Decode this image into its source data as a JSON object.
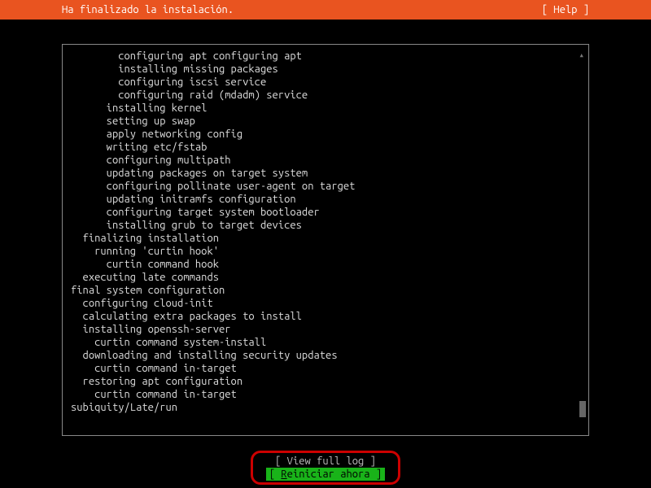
{
  "header": {
    "title": "Ha finalizado la instalación.",
    "help": "[ Help ]"
  },
  "log": {
    "lines": [
      "        configuring apt configuring apt",
      "        installing missing packages",
      "        configuring iscsi service",
      "        configuring raid (mdadm) service",
      "      installing kernel",
      "      setting up swap",
      "      apply networking config",
      "      writing etc/fstab",
      "      configuring multipath",
      "      updating packages on target system",
      "      configuring pollinate user-agent on target",
      "      updating initramfs configuration",
      "      configuring target system bootloader",
      "      installing grub to target devices",
      "  finalizing installation",
      "    running 'curtin hook'",
      "      curtin command hook",
      "  executing late commands",
      "final system configuration",
      "  configuring cloud-init",
      "  calculating extra packages to install",
      "  installing openssh-server",
      "    curtin command system-install",
      "  downloading and installing security updates",
      "    curtin command in-target",
      "  restoring apt configuration",
      "    curtin command in-target",
      "subiquity/Late/run"
    ]
  },
  "footer": {
    "view_log_label": "[ View full log   ]",
    "reboot_prefix": "[ ",
    "reboot_underline": "R",
    "reboot_rest": "einiciar ahora ]"
  }
}
